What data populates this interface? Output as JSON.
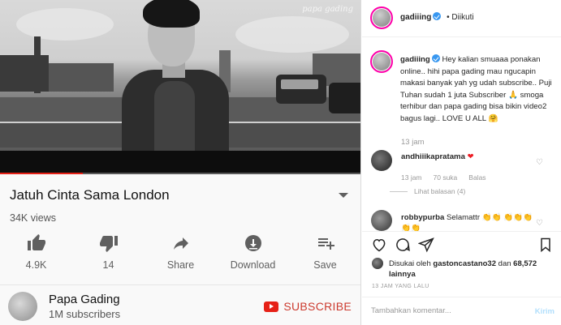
{
  "youtube": {
    "video": {
      "watermark": "papa gading",
      "progress_fraction": 0.23
    },
    "title": "Jatuh Cinta Sama London",
    "views": "34K views",
    "actions": [
      {
        "icon": "thumbs-up-icon",
        "label": "4.9K"
      },
      {
        "icon": "thumbs-down-icon",
        "label": "14"
      },
      {
        "icon": "share-icon",
        "label": "Share"
      },
      {
        "icon": "download-icon",
        "label": "Download"
      },
      {
        "icon": "save-playlist-icon",
        "label": "Save"
      }
    ],
    "channel": {
      "name": "Papa Gading",
      "subscribers": "1M subscribers",
      "subscribe_label": "SUBSCRIBE"
    },
    "colors": {
      "accent": "#e62117",
      "subscribe": "#cc3b2f"
    }
  },
  "instagram": {
    "header": {
      "username": "gadiiing",
      "follow_state": "• Diikuti"
    },
    "caption": {
      "username": "gadiiing",
      "text": "Hey kalian smuaaa ponakan online.. hihi papa gading mau ngucapin makasi banyak yah yg udah subscribe.. Puji Tuhan sudah 1 juta Subscriber 🙏 smoga terhibur dan papa gading bisa bikin video2 bagus lagi.. LOVE U ALL 🤗",
      "time": "13 jam"
    },
    "comments": [
      {
        "username": "andhiiikapratama",
        "text": "❤",
        "time": "13 jam",
        "likes": "70 suka",
        "reply": "Balas",
        "view_replies": "Lihat balasan (4)"
      },
      {
        "username": "robbypurba",
        "text": "Selamattr 👏👏 👏👏👏👏👏"
      }
    ],
    "liked_by": {
      "prefix": "Disukai oleh",
      "user": "gastoncastano32",
      "connector": "dan",
      "others": "68,572 lainnya"
    },
    "posted": "13 JAM YANG LALU",
    "comment_input": {
      "placeholder": "Tambahkan komentar...",
      "send_label": "Kirim"
    },
    "colors": {
      "verified": "#3897f0",
      "send": "#b2dffc"
    }
  }
}
